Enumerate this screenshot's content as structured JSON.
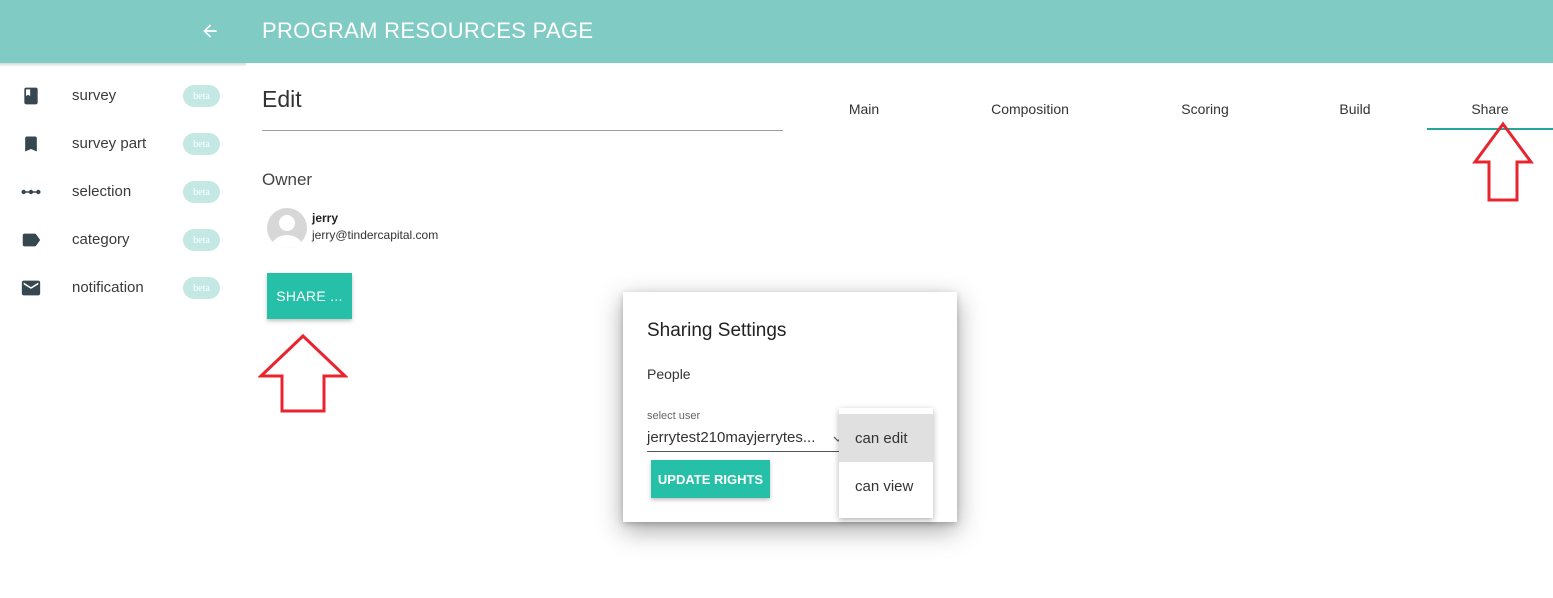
{
  "header": {
    "title": "PROGRAM RESOURCES PAGE",
    "back_icon": "arrow-left-icon",
    "background": "#80cbc4"
  },
  "sidebar": {
    "items": [
      {
        "label": "survey",
        "icon": "book-icon",
        "badge": "beta"
      },
      {
        "label": "survey part",
        "icon": "bookmark-icon",
        "badge": "beta"
      },
      {
        "label": "selection",
        "icon": "dots-line-icon",
        "badge": "beta"
      },
      {
        "label": "category",
        "icon": "label-tag-icon",
        "badge": "beta"
      },
      {
        "label": "notification",
        "icon": "envelope-icon",
        "badge": "beta"
      }
    ]
  },
  "main": {
    "edit_title": "Edit",
    "tabs": [
      {
        "label": "Main",
        "active": false
      },
      {
        "label": "Composition",
        "active": false
      },
      {
        "label": "Scoring",
        "active": false
      },
      {
        "label": "Build",
        "active": false
      },
      {
        "label": "Share",
        "active": true
      }
    ],
    "owner_label": "Owner",
    "owner": {
      "name": "jerry",
      "email": "jerry@tindercapital.com"
    },
    "share_button": "SHARE ..."
  },
  "dialog": {
    "title": "Sharing Settings",
    "people_label": "People",
    "select_label": "select user",
    "select_value": "jerrytest210mayjerrytes...",
    "update_button": "UPDATE RIGHTS",
    "dropdown_options": [
      {
        "label": "can edit",
        "selected": true
      },
      {
        "label": "can view",
        "selected": false
      }
    ]
  },
  "colors": {
    "accent": "#26bfa7",
    "tab_indicator": "#26a69a",
    "annotation": "#e8252f"
  }
}
